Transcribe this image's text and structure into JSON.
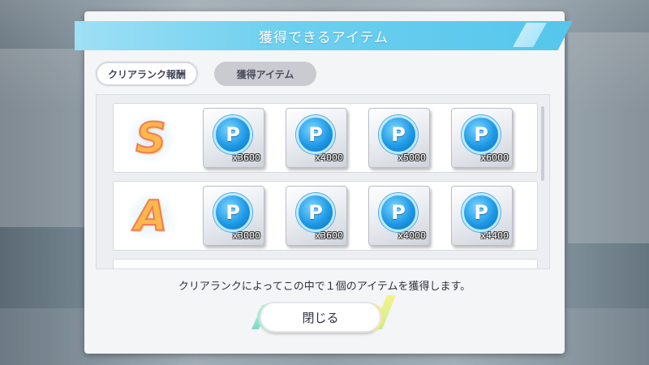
{
  "dialog": {
    "title": "獲得できるアイテム",
    "tabs": [
      {
        "label": "クリアランク報酬",
        "active": true
      },
      {
        "label": "獲得アイテム",
        "active": false
      }
    ],
    "ranks": [
      {
        "rank": "S",
        "items": [
          {
            "icon": "p-coin-icon",
            "glyph": "P",
            "quantity": "x3600"
          },
          {
            "icon": "p-coin-icon",
            "glyph": "P",
            "quantity": "x4000"
          },
          {
            "icon": "p-coin-icon",
            "glyph": "P",
            "quantity": "x5000"
          },
          {
            "icon": "p-coin-icon",
            "glyph": "P",
            "quantity": "x6000"
          }
        ]
      },
      {
        "rank": "A",
        "items": [
          {
            "icon": "p-coin-icon",
            "glyph": "P",
            "quantity": "x3000"
          },
          {
            "icon": "p-coin-icon",
            "glyph": "P",
            "quantity": "x3600"
          },
          {
            "icon": "p-coin-icon",
            "glyph": "P",
            "quantity": "x4000"
          },
          {
            "icon": "p-coin-icon",
            "glyph": "P",
            "quantity": "x4400"
          }
        ]
      }
    ],
    "note": "クリアランクによってこの中で１個のアイテムを獲得します。",
    "close_label": "閉じる"
  },
  "colors": {
    "title_bar": "#55c6ec",
    "coin": "#1e9ae6",
    "rank_letter": "#ffb84a"
  }
}
